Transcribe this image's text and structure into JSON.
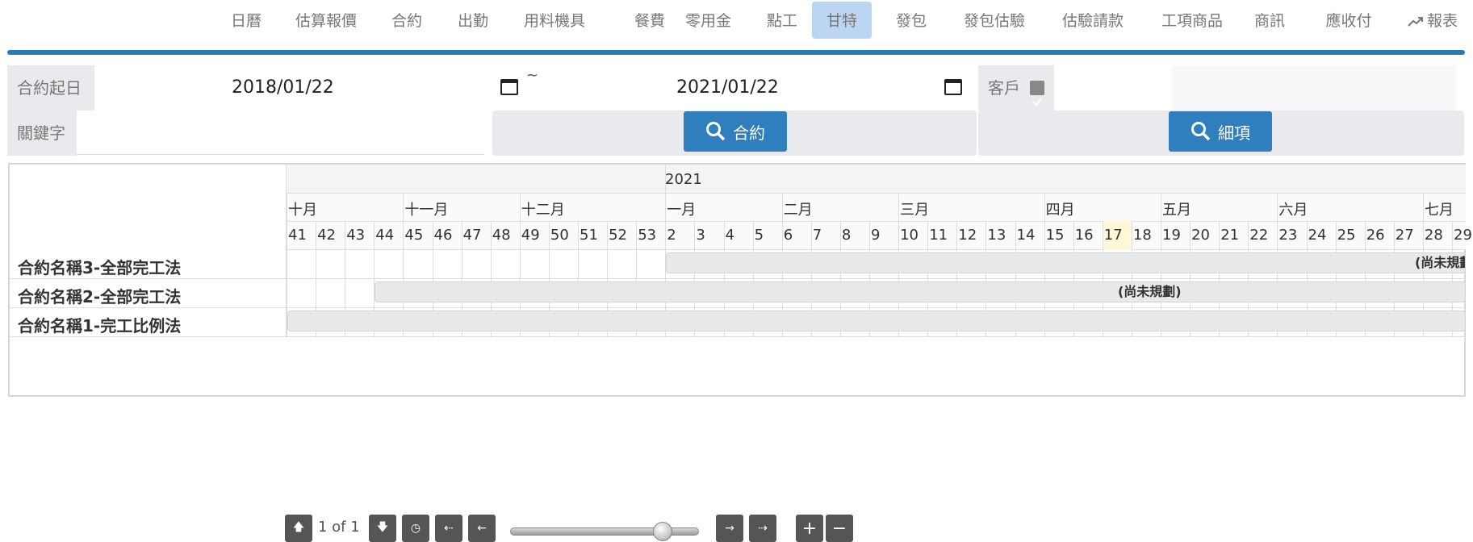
{
  "nav": {
    "items": [
      "日曆",
      "估算報價",
      "合約",
      "出勤",
      "用料機具",
      "餐費",
      "零用金",
      "點工",
      "甘特",
      "發包",
      "發包估驗",
      "估驗請款",
      "工項商品",
      "商訊",
      "應收付",
      "報表"
    ],
    "active": "甘特"
  },
  "filters": {
    "start_label": "合約起日",
    "start_value": "2018/01/22",
    "tilde": "~",
    "end_value": "2021/01/22",
    "customer_label": "客戶",
    "customer_checked": true,
    "keyword_label": "關鍵字",
    "keyword_value": "",
    "contract_button": "合約",
    "detail_button": "細項"
  },
  "gantt": {
    "year": "2021",
    "months": [
      "十月",
      "十一月",
      "十二月",
      "一月",
      "二月",
      "三月",
      "四月",
      "五月",
      "六月",
      "七月"
    ],
    "weeks": [
      "41",
      "42",
      "43",
      "44",
      "45",
      "46",
      "47",
      "48",
      "49",
      "50",
      "51",
      "52",
      "53",
      "2",
      "3",
      "4",
      "5",
      "6",
      "7",
      "8",
      "9",
      "10",
      "11",
      "12",
      "13",
      "14",
      "15",
      "16",
      "17",
      "18",
      "19",
      "20",
      "21",
      "22",
      "23",
      "24",
      "25",
      "26",
      "27",
      "28",
      "29"
    ],
    "highlight_week": "17",
    "rows": [
      {
        "name": "合約名稱3-全部完工法",
        "bar_label": "(尚未規劃)"
      },
      {
        "name": "合約名稱2-全部完工法",
        "bar_label": "(尚未規劃)"
      },
      {
        "name": "合約名稱1-完工比例法",
        "bar_label": ""
      }
    ],
    "pager": "1 of 1"
  },
  "colors": {
    "accent": "#2e7bb3",
    "button": "#2f7fbf",
    "active_tab": "#bcd5f2",
    "highlight": "#fff8d6"
  }
}
